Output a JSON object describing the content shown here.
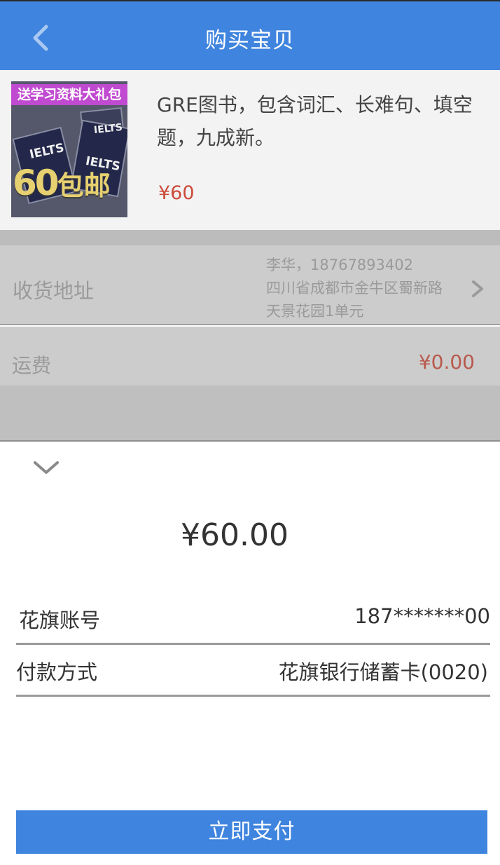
{
  "header": {
    "title": "购买宝贝"
  },
  "product": {
    "image": {
      "banner_text": "送学习资料大礼包",
      "promo_number": "60",
      "promo_text": "包邮",
      "book_label": "IELTS",
      "book_label_alt": "IELTS",
      "book_label_small": "IELTS"
    },
    "description": "GRE图书，包含词汇、长难句、填空题，九成新。",
    "price": "¥60"
  },
  "address": {
    "label": "收货地址",
    "contact": "李华，18767893402",
    "detail": "四川省成都市金牛区蜀新路天景花园1单元"
  },
  "shipping": {
    "label": "运费",
    "value": "¥0.00"
  },
  "payment": {
    "amount": "¥60.00",
    "account_label": "花旗账号",
    "account_value": "187*******00",
    "method_label": "付款方式",
    "method_value": "花旗银行储蓄卡(0020)",
    "pay_button_label": "立即支付"
  },
  "colors": {
    "primary": "#3f84de",
    "price": "#cc4a3a",
    "overlay": "#cccccc"
  }
}
